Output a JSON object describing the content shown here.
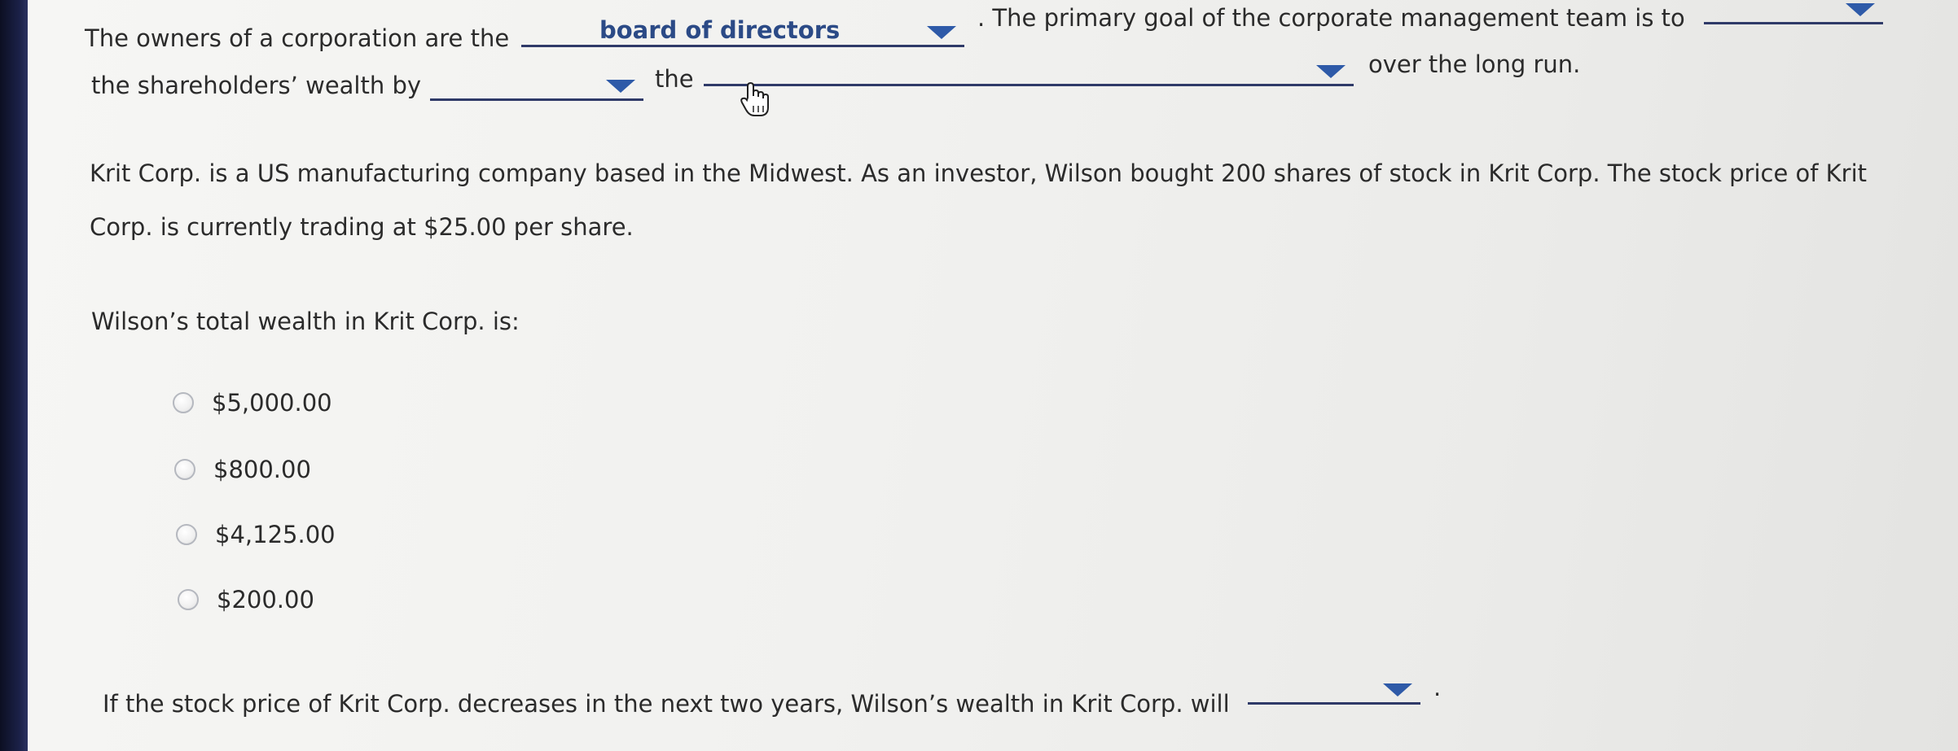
{
  "q1": {
    "line1_prefix": "The owners of a corporation are the",
    "owners_dropdown_value": "board of directors",
    "line1_middle": ". The primary goal of the corporate management team is to",
    "line2_prefix": "the shareholders’ wealth by",
    "line2_the": "the",
    "line2_suffix": "over the long run."
  },
  "scenario": {
    "line1": "Krit Corp. is a US manufacturing company based in the Midwest. As an investor, Wilson bought 200 shares of stock in Krit Corp. The stock price of Krit",
    "line2": "Corp. is currently trading at $25.00 per share."
  },
  "q2": {
    "prompt": "Wilson’s total wealth in Krit Corp. is:",
    "options": [
      "$5,000.00",
      "$800.00",
      "$4,125.00",
      "$200.00"
    ]
  },
  "q3": {
    "prompt": "If the stock price of Krit Corp. decreases in the next two years, Wilson’s wealth in Krit Corp. will",
    "end_punct": "."
  },
  "colors": {
    "dropdown_underline": "#2f3a68",
    "caret": "#2e5aa8",
    "selected_value": "#2b4a86"
  },
  "icons": {
    "caret": "triangle-down",
    "cursor": "pointing-hand-cursor"
  }
}
